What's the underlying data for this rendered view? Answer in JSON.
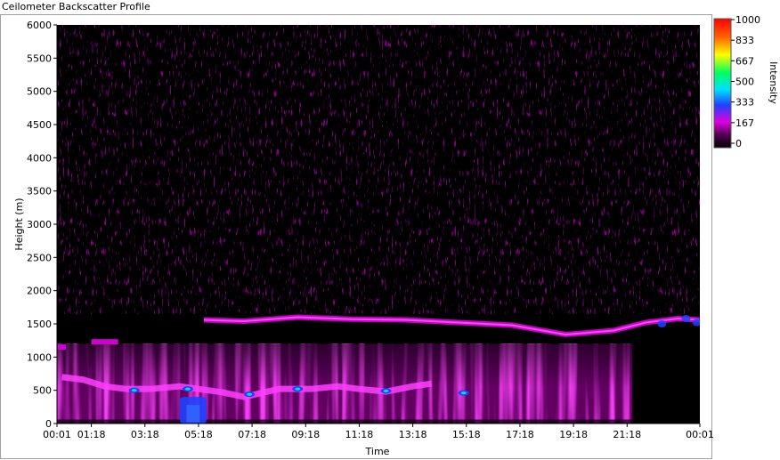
{
  "window": {
    "title": "Ceilometer Backscatter Profile"
  },
  "colors": {
    "background": "#000000",
    "colormap": [
      "#000000",
      "#e000e0",
      "#2040ff",
      "#00e0ff",
      "#00ff60",
      "#ffff00",
      "#ff6000",
      "#ff0000"
    ]
  },
  "chart_data": {
    "type": "heatmap",
    "title": "",
    "xlabel": "Time",
    "ylabel": "Height (m)",
    "x_ticks": [
      "00:01",
      "01:18",
      "03:18",
      "05:18",
      "07:18",
      "09:18",
      "11:18",
      "13:18",
      "15:18",
      "17:18",
      "19:18",
      "21:18",
      "00:01"
    ],
    "x_tick_hours": [
      0.0167,
      1.3,
      3.3,
      5.3,
      7.3,
      9.3,
      11.3,
      13.3,
      15.3,
      17.3,
      19.3,
      21.3,
      24.0167
    ],
    "xlim_hours": [
      0.0167,
      24.0167
    ],
    "y_ticks": [
      0,
      500,
      1000,
      1500,
      2000,
      2500,
      3000,
      3500,
      4000,
      4500,
      5000,
      5500,
      6000
    ],
    "ylim": [
      0,
      6000
    ],
    "colorbar": {
      "label": "Intensity",
      "ticks": [
        "1000",
        "833",
        "667",
        "500",
        "333",
        "167",
        "0"
      ],
      "range": [
        0,
        1000
      ]
    },
    "features": [
      {
        "name": "upper cloud layer",
        "height_m": 1550,
        "hours": [
          5.5,
          24.0
        ],
        "intensity": 200
      },
      {
        "name": "early layer",
        "height_m": 1230,
        "hours": [
          1.3,
          2.3
        ],
        "intensity": 180
      },
      {
        "name": "boundary layer",
        "height_m": [
          0,
          1200
        ],
        "hours": [
          0.0,
          21.5
        ],
        "intensity": 180
      },
      {
        "name": "lower cloud layer",
        "height_m": 550,
        "hours": [
          0.2,
          14.0
        ],
        "intensity": 330
      },
      {
        "name": "strong return",
        "height_m": [
          0,
          400
        ],
        "hours": [
          4.6,
          5.6
        ],
        "intensity": 360
      }
    ]
  }
}
